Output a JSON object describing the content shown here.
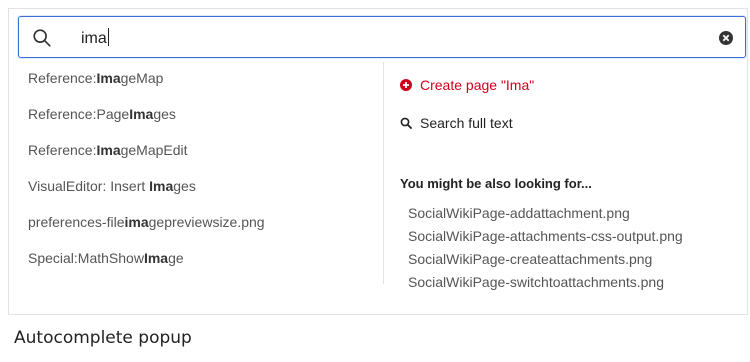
{
  "search": {
    "value": "ima"
  },
  "results": [
    {
      "prefix": "Reference:",
      "match": "Ima",
      "suffix": "geMap"
    },
    {
      "prefix": "Reference:Page",
      "match": "Ima",
      "suffix": "ges"
    },
    {
      "prefix": "Reference:",
      "match": "Ima",
      "suffix": "geMapEdit"
    },
    {
      "prefix": "VisualEditor: Insert ",
      "match": "Ima",
      "suffix": "ges"
    },
    {
      "prefix": "preferences-file",
      "match": "ima",
      "suffix": "gepreviewsize.png"
    },
    {
      "prefix": "Special:MathShow",
      "match": "Ima",
      "suffix": "ge"
    }
  ],
  "actions": {
    "create_label": "Create page \"Ima\"",
    "fulltext_label": "Search full text"
  },
  "also": {
    "heading": "You might be also looking for...",
    "items": [
      "SocialWikiPage-addattachment.png",
      "SocialWikiPage-attachments-css-output.png",
      "SocialWikiPage-createattachments.png",
      "SocialWikiPage-switchtoattachments.png"
    ]
  },
  "caption": "Autocomplete popup",
  "colors": {
    "accent": "#3a6fd8",
    "create": "#d0021b"
  },
  "icons": [
    "search-icon",
    "clear-icon",
    "plus-circle-icon",
    "search-small-icon"
  ]
}
